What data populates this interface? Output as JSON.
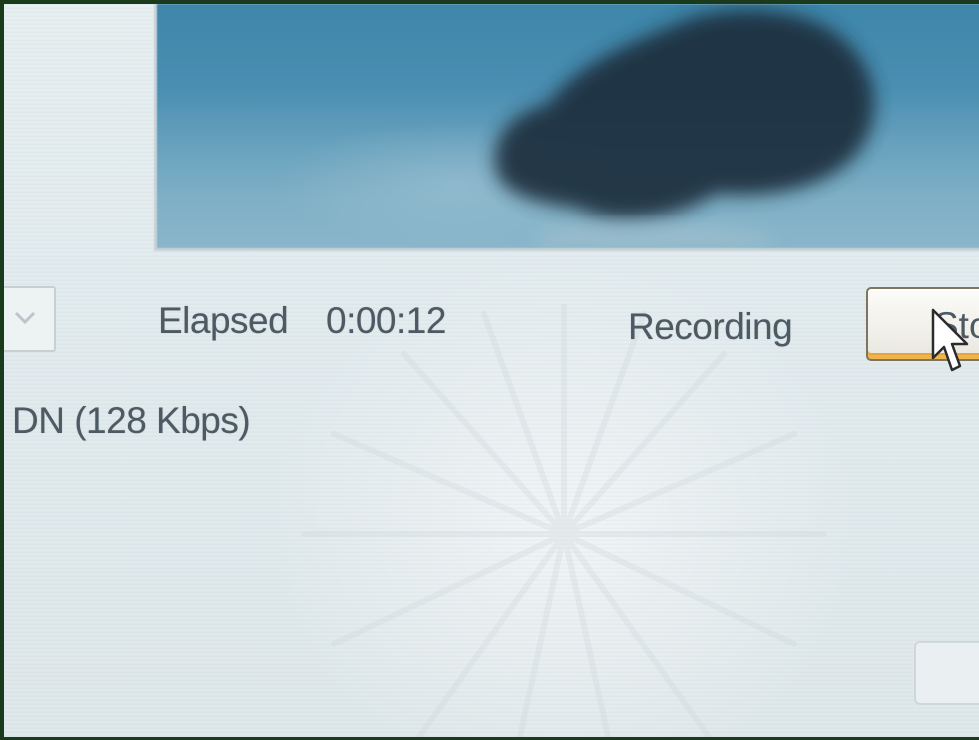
{
  "recorder": {
    "elapsed_label": "Elapsed",
    "elapsed_time": "0:00:12",
    "status": "Recording",
    "stop_button_label": "Sto",
    "bitrate_text": "DN (128 Kbps)"
  },
  "colors": {
    "frame_border": "#1a3a1c",
    "background": "#e4ecee",
    "text": "#4d5a63",
    "button_focus": "#f0b44c",
    "preview_sky": "#4b8fb2"
  },
  "icons": {
    "dropdown": "chevron-down-icon",
    "cursor": "mouse-pointer-icon"
  }
}
